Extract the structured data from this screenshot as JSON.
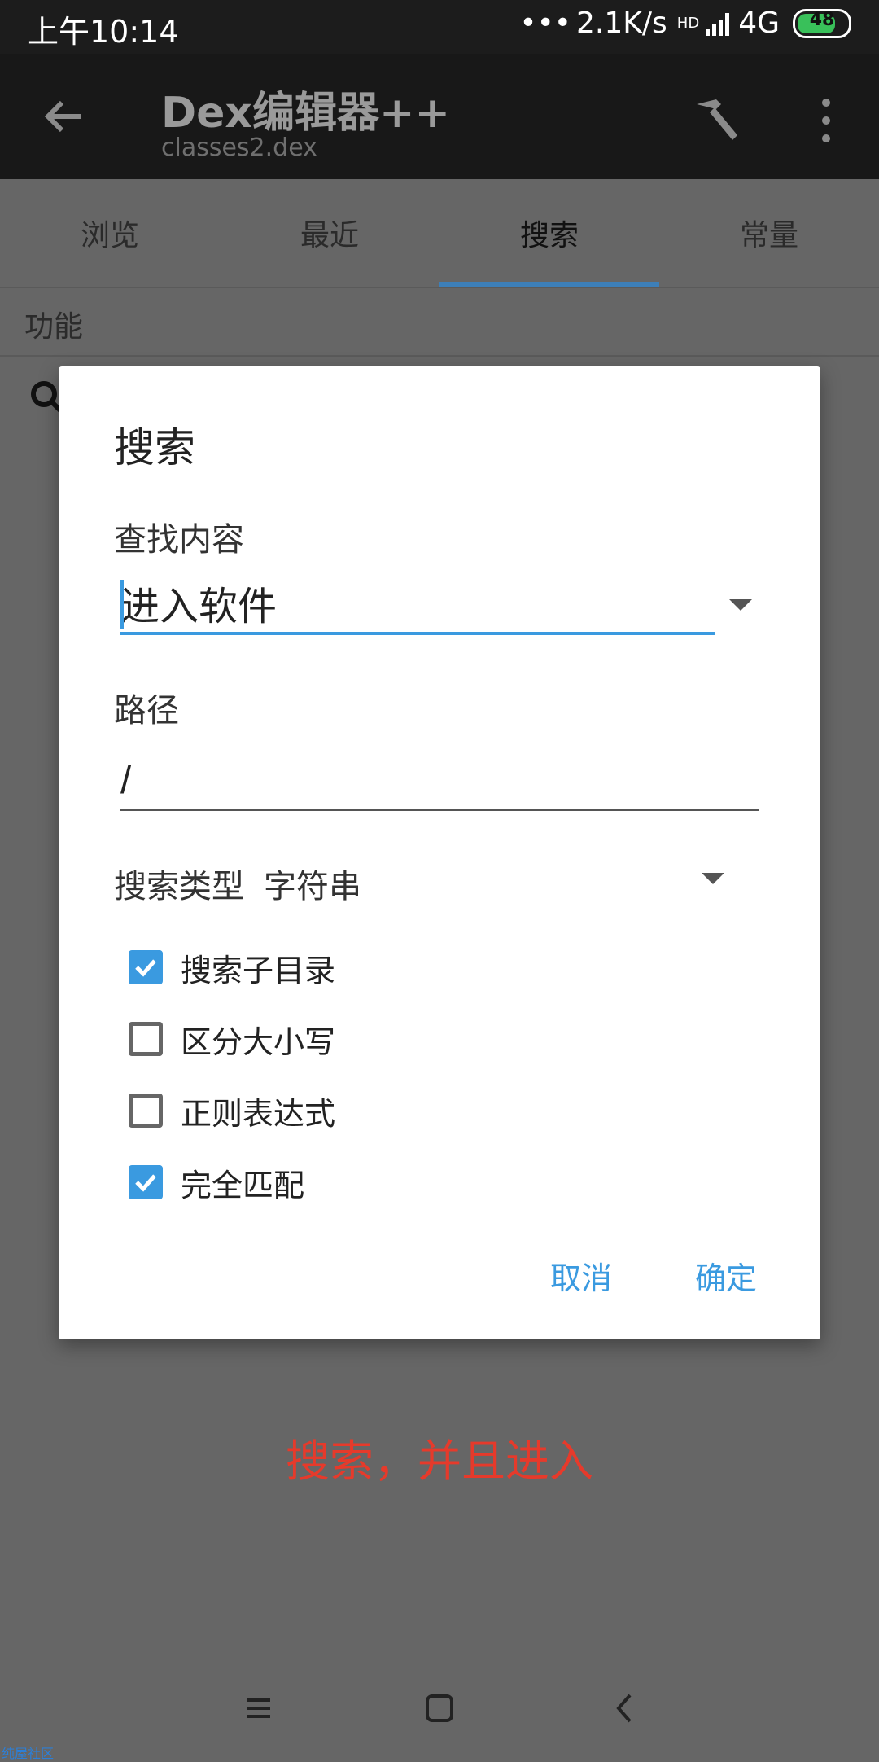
{
  "status_bar": {
    "time": "上午10:14",
    "network_speed": "2.1K/s",
    "hd_label": "HD",
    "network_type": "4G",
    "battery": "48"
  },
  "app_bar": {
    "title": "Dex编辑器++",
    "subtitle": "classes2.dex"
  },
  "tabs": [
    {
      "label": "浏览"
    },
    {
      "label": "最近"
    },
    {
      "label": "搜索"
    },
    {
      "label": "常量"
    }
  ],
  "section": {
    "label": "功能"
  },
  "dialog": {
    "title": "搜索",
    "find_label": "查找内容",
    "find_value": "进入软件",
    "path_label": "路径",
    "path_value": "/",
    "type_label": "搜索类型",
    "type_value": "字符串",
    "options": [
      {
        "label": "搜索子目录",
        "checked": true
      },
      {
        "label": "区分大小写",
        "checked": false
      },
      {
        "label": "正则表达式",
        "checked": false
      },
      {
        "label": "完全匹配",
        "checked": true
      }
    ],
    "cancel_label": "取消",
    "ok_label": "确定"
  },
  "annotation": "搜索，并且进入",
  "watermark": "纯屋社区",
  "colors": {
    "accent": "#3a9ae0",
    "annotation": "#e63a2b",
    "tab_indicator": "#3d7fb8"
  }
}
